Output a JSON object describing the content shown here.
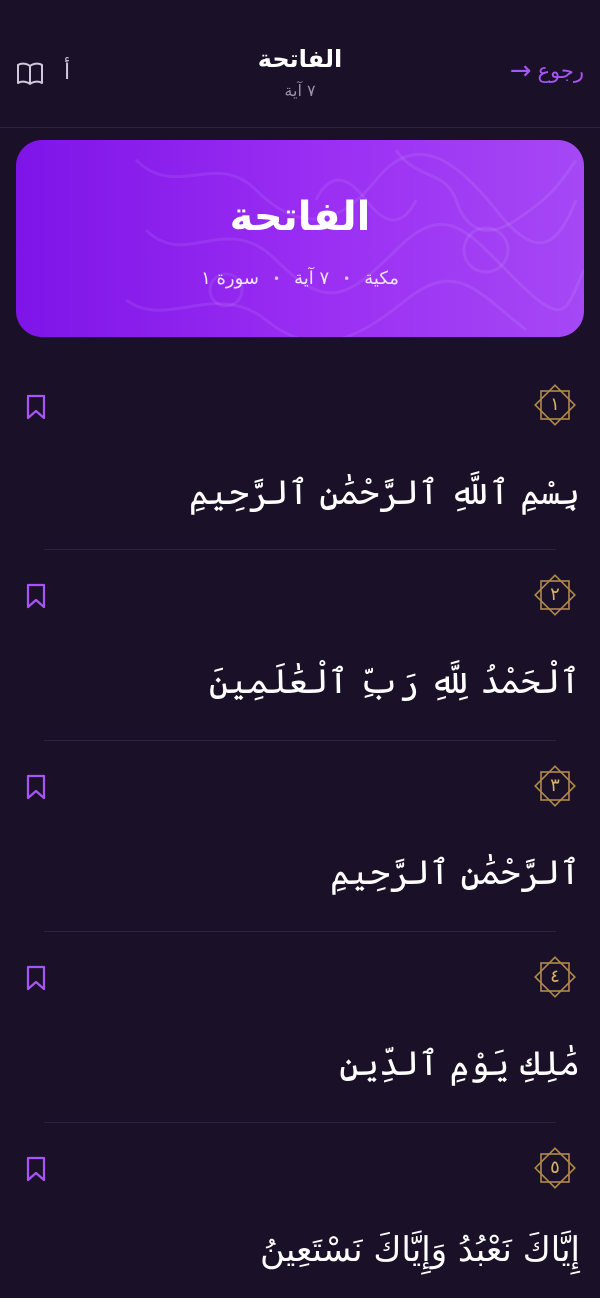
{
  "header": {
    "back_label": "رجوع",
    "title": "الفاتحة",
    "subtitle": "٧ آية",
    "font_label": "أ"
  },
  "banner": {
    "title": "الفاتحة",
    "revelation": "مكية",
    "ayah_count": "٧ آية",
    "surah_number": "سورة ١"
  },
  "colors": {
    "background": "#1a1128",
    "accent": "#a855f7",
    "gold": "#b08a4a"
  },
  "verses": [
    {
      "number": "١",
      "text": "بِسْمِ ٱللَّهِ ٱلرَّحْمَٰنِ ٱلرَّحِيمِ"
    },
    {
      "number": "٢",
      "text": "ٱلْحَمْدُ لِلَّهِ رَبِّ ٱلْعَٰلَمِينَ"
    },
    {
      "number": "٣",
      "text": "ٱلرَّحْمَٰنِ ٱلرَّحِيمِ"
    },
    {
      "number": "٤",
      "text": "مَٰلِكِ يَوْمِ ٱلدِّينِ"
    },
    {
      "number": "٥",
      "text": "إِيَّاكَ نَعْبُدُ وَإِيَّاكَ نَسْتَعِينُ"
    }
  ]
}
